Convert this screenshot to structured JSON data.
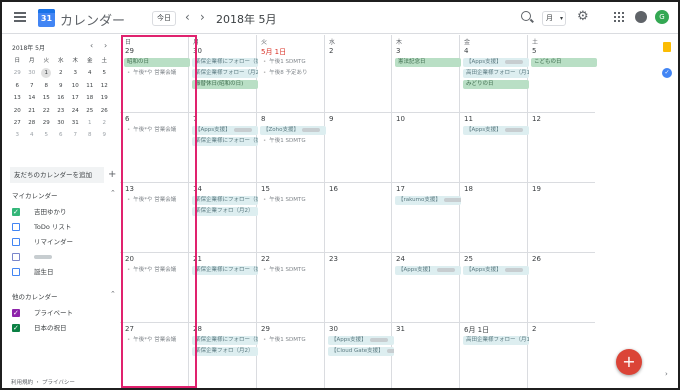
{
  "header": {
    "app_title": "カレンダー",
    "today_label": "今日",
    "month_title": "2018年 5月",
    "view_label": "月",
    "avatar_initial": "G"
  },
  "mini_calendar": {
    "title": "2018年 5月",
    "weekdays": [
      "日",
      "月",
      "火",
      "水",
      "木",
      "金",
      "土"
    ],
    "days": [
      [
        "29",
        "30",
        "1",
        "2",
        "3",
        "4",
        "5"
      ],
      [
        "6",
        "7",
        "8",
        "9",
        "10",
        "11",
        "12"
      ],
      [
        "13",
        "14",
        "15",
        "16",
        "17",
        "18",
        "19"
      ],
      [
        "20",
        "21",
        "22",
        "23",
        "24",
        "25",
        "26"
      ],
      [
        "27",
        "28",
        "29",
        "30",
        "31",
        "1",
        "2"
      ],
      [
        "3",
        "4",
        "5",
        "6",
        "7",
        "8",
        "9"
      ]
    ],
    "selected_day": "1"
  },
  "sidebar": {
    "add_friend_label": "友だちのカレンダーを追加",
    "my_calendars_title": "マイカレンダー",
    "my_calendars": [
      {
        "label": "吉田ゆかり",
        "color": "#33b679",
        "checked": true
      },
      {
        "label": "ToDo リスト",
        "color": "#4285f4",
        "checked": false
      },
      {
        "label": "リマインダー",
        "color": "#4285f4",
        "checked": false
      },
      {
        "label": "",
        "color": "#7986cb",
        "checked": false
      },
      {
        "label": "誕生日",
        "color": "#4285f4",
        "checked": false
      }
    ],
    "other_calendars_title": "他のカレンダー",
    "other_calendars": [
      {
        "label": "プライベート",
        "color": "#8e24aa",
        "checked": true
      },
      {
        "label": "日本の祝日",
        "color": "#0b8043",
        "checked": true
      }
    ],
    "footer": "利用規約 ・ プライバシー"
  },
  "grid": {
    "weekday_labels": [
      "日",
      "月",
      "火",
      "水",
      "木",
      "金",
      "土"
    ],
    "weeks": [
      [
        {
          "day": "29",
          "events": [
            {
              "style": "g",
              "text": "昭和の日"
            },
            {
              "style": "plain",
              "text": "午後*や 営業会議"
            }
          ]
        },
        {
          "day": "30",
          "events": [
            {
              "style": "t",
              "text": "某保企業様にフォロー（提"
            },
            {
              "style": "t",
              "text": "某保企業様フォロー（月2）"
            },
            {
              "style": "g",
              "text": "振替休日(昭和の日)"
            }
          ]
        },
        {
          "day": "5月 1日",
          "events": [
            {
              "style": "plain",
              "text": "午後1 SDMTG"
            },
            {
              "style": "plain",
              "text": "午後8 予定あり"
            }
          ]
        },
        {
          "day": "2",
          "events": []
        },
        {
          "day": "3",
          "events": [
            {
              "style": "g",
              "text": "憲法記念日"
            }
          ]
        },
        {
          "day": "4",
          "events": [
            {
              "style": "t",
              "text": "【Apps支援】"
            },
            {
              "style": "t",
              "text": "高田企業様フォロー（月1）"
            },
            {
              "style": "g",
              "text": "みどりの日"
            }
          ]
        },
        {
          "day": "5",
          "events": [
            {
              "style": "g",
              "text": "こどもの日"
            }
          ]
        }
      ],
      [
        {
          "day": "6",
          "events": [
            {
              "style": "plain",
              "text": "午後*や 営業会議"
            }
          ]
        },
        {
          "day": "7",
          "events": [
            {
              "style": "t",
              "text": "【Apps支援】"
            },
            {
              "style": "t",
              "text": "某保企業様にフォロー（提"
            }
          ]
        },
        {
          "day": "8",
          "events": [
            {
              "style": "t",
              "text": "【Zoho支援】"
            },
            {
              "style": "plain",
              "text": "午後1 SDMTG"
            }
          ]
        },
        {
          "day": "9",
          "events": []
        },
        {
          "day": "10",
          "events": []
        },
        {
          "day": "11",
          "events": [
            {
              "style": "t",
              "text": "【Apps支援】"
            }
          ]
        },
        {
          "day": "12",
          "events": []
        }
      ],
      [
        {
          "day": "13",
          "events": [
            {
              "style": "plain",
              "text": "午後*や 営業会議"
            }
          ]
        },
        {
          "day": "14",
          "events": [
            {
              "style": "t",
              "text": "某保企業様にフォロー（提"
            },
            {
              "style": "t",
              "text": "某保企業フォロ（月2）"
            }
          ]
        },
        {
          "day": "15",
          "events": [
            {
              "style": "plain",
              "text": "午後1 SDMTG"
            }
          ]
        },
        {
          "day": "16",
          "events": []
        },
        {
          "day": "17",
          "events": [
            {
              "style": "t",
              "text": "【rakumo支援】"
            }
          ]
        },
        {
          "day": "18",
          "events": []
        },
        {
          "day": "19",
          "events": []
        }
      ],
      [
        {
          "day": "20",
          "events": [
            {
              "style": "plain",
              "text": "午後*や 営業会議"
            }
          ]
        },
        {
          "day": "21",
          "events": [
            {
              "style": "t",
              "text": "某保企業様にフォロー（提"
            }
          ]
        },
        {
          "day": "22",
          "events": [
            {
              "style": "plain",
              "text": "午後1 SDMTG"
            }
          ]
        },
        {
          "day": "23",
          "events": []
        },
        {
          "day": "24",
          "events": [
            {
              "style": "t",
              "text": "【Apps支援】"
            }
          ]
        },
        {
          "day": "25",
          "events": [
            {
              "style": "t",
              "text": "【Apps支援】"
            }
          ]
        },
        {
          "day": "26",
          "events": []
        }
      ],
      [
        {
          "day": "27",
          "events": [
            {
              "style": "plain",
              "text": "午後*や 営業会議"
            }
          ]
        },
        {
          "day": "28",
          "events": [
            {
              "style": "t",
              "text": "某保企業様にフォロー（提"
            },
            {
              "style": "t",
              "text": "某保企業フォロ（月2）"
            }
          ]
        },
        {
          "day": "29",
          "events": [
            {
              "style": "plain",
              "text": "午後1 SDMTG"
            }
          ]
        },
        {
          "day": "30",
          "events": [
            {
              "style": "t",
              "text": "【Apps支援】"
            },
            {
              "style": "t",
              "text": "【Cloud Gate支援】"
            }
          ]
        },
        {
          "day": "31",
          "events": []
        },
        {
          "day": "6月 1日",
          "events": [
            {
              "style": "t",
              "text": "高田企業様フォロー（月1）"
            }
          ]
        },
        {
          "day": "2",
          "events": []
        }
      ]
    ]
  },
  "fab_label": "+"
}
